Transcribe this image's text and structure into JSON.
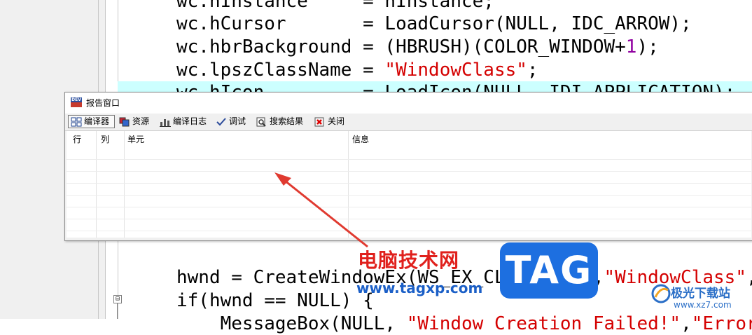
{
  "editor": {
    "code_lines": [
      {
        "parts": [
          {
            "t": "wc.hInstance     = hInstance;",
            "k": "p"
          }
        ]
      },
      {
        "parts": [
          {
            "t": "wc.hCursor       = LoadCursor(NULL, IDC_ARROW);",
            "k": "p"
          }
        ]
      },
      {
        "parts": [
          {
            "t": "wc.hbrBackground = (HBRUSH)(COLOR_WINDOW+",
            "k": "p"
          },
          {
            "t": "1",
            "k": "n"
          },
          {
            "t": ");",
            "k": "p"
          }
        ]
      },
      {
        "parts": [
          {
            "t": "wc.lpszClassName = ",
            "k": "p"
          },
          {
            "t": "\"WindowClass\"",
            "k": "s"
          },
          {
            "t": ";",
            "k": "p"
          }
        ]
      },
      {
        "parts": [
          {
            "t": "wc.hIcon         = LoadIcon(NULL, IDI_APPLICATION);",
            "k": "p"
          }
        ]
      },
      {
        "parts": [
          {
            "t": "hwnd = CreateWindowEx(WS_EX_CLIENTEDGE,",
            "k": "p"
          },
          {
            "t": "\"WindowClass\"",
            "k": "s"
          },
          {
            "t": ",",
            "k": "p"
          }
        ]
      },
      {
        "parts": [
          {
            "t": "if(hwnd == NULL) {",
            "k": "p"
          }
        ]
      },
      {
        "parts": [
          {
            "t": "    MessageBox(NULL, ",
            "k": "p"
          },
          {
            "t": "\"Window Creation Failed!\"",
            "k": "s"
          },
          {
            "t": ",",
            "k": "p"
          },
          {
            "t": "\"Error!\"",
            "k": "s"
          }
        ]
      }
    ],
    "fold_symbol": "⊟"
  },
  "report_window": {
    "title": "报告窗口",
    "tabs": [
      {
        "label": "编译器",
        "icon": "grid-icon",
        "active": true
      },
      {
        "label": "资源",
        "icon": "resources-icon",
        "active": false
      },
      {
        "label": "编译日志",
        "icon": "bar-chart-icon",
        "active": false
      },
      {
        "label": "调试",
        "icon": "checkmark-icon",
        "active": false
      },
      {
        "label": "搜索结果",
        "icon": "search-doc-icon",
        "active": false
      },
      {
        "label": "关闭",
        "icon": "close-red-icon",
        "active": false
      }
    ],
    "columns": [
      "行",
      "列",
      "单元",
      "信息"
    ]
  },
  "watermark": {
    "site_name": "电脑技术网",
    "site_url": "www.tagxp.com",
    "tag_text": "TAG",
    "logo_name": "极光下载站",
    "logo_url": "www.xz7.com"
  },
  "colors": {
    "highlight_row": "#ccffff",
    "string": "#d40000",
    "number": "#9000a0",
    "annotation_arrow": "#e03a30",
    "tag_blue": "#1d6fe0"
  }
}
